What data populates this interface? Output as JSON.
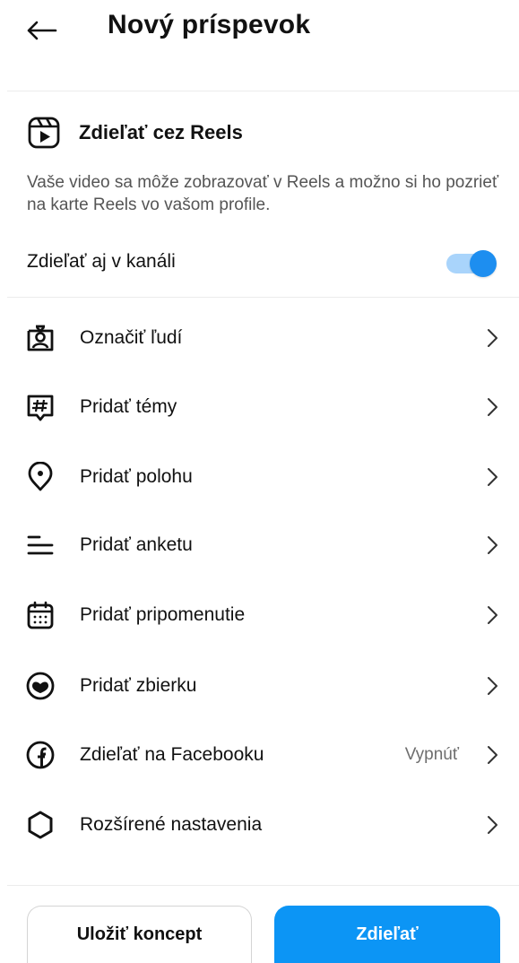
{
  "header": {
    "title": "Nový príspevok",
    "back_icon": "arrow-left-icon"
  },
  "reels": {
    "title": "Zdieľať cez Reels",
    "icon": "reels-icon",
    "description": "Vaše video sa môže zobrazovať v Reels a možno si ho pozrieť na karte Reels vo vašom profile.",
    "feed_label": "Zdieľať aj v kanáli",
    "feed_toggle_on": true
  },
  "menu": {
    "items": [
      {
        "label": "Označiť ľudí",
        "icon": "tag-people-icon"
      },
      {
        "label": "Pridať témy",
        "icon": "hashtag-icon"
      },
      {
        "label": "Pridať polohu",
        "icon": "location-pin-icon"
      },
      {
        "label": "Pridať anketu",
        "icon": "poll-lines-icon"
      },
      {
        "label": "Pridať pripomenutie",
        "icon": "calendar-icon"
      },
      {
        "label": "Pridať zbierku",
        "icon": "collection-heart-icon"
      },
      {
        "label": "Zdieľať na Facebooku",
        "icon": "facebook-icon",
        "value": "Vypnúť"
      },
      {
        "label": "Rozšírené nastavenia",
        "icon": "settings-gear-icon"
      }
    ]
  },
  "footer": {
    "draft_label": "Uložiť koncept",
    "share_label": "Zdieľať"
  },
  "colors": {
    "accent": "#0c95f5",
    "toggle_knob": "#1d8ef0",
    "toggle_track": "#a9d4fb"
  }
}
